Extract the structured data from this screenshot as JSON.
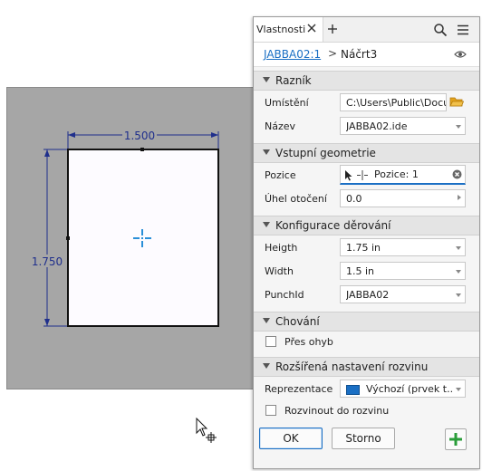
{
  "canvas": {
    "dim_width": "1.500",
    "dim_height": "1.750"
  },
  "panel": {
    "tab_label": "Vlastnosti",
    "breadcrumb": {
      "link": "JABBA02:1",
      "separator": ">",
      "current": "Náčrt3"
    },
    "sections": {
      "punch": "Razník",
      "input_geometry": "Vstupní geometrie",
      "punch_config": "Konfigurace děrování",
      "behavior": "Chování",
      "advanced": "Rozšířená nastavení rozvinu"
    },
    "fields": {
      "location_label": "Umístění",
      "location_value": "C:\\Users\\Public\\Docum",
      "name_label": "Název",
      "name_value": "JABBA02.ide",
      "position_label": "Pozice",
      "position_value": "Pozice: 1",
      "angle_label": "Úhel otočení",
      "angle_value": "0.0",
      "height_label": "Heigth",
      "height_value": "1.75 in",
      "width_label": "Width",
      "width_value": "1.5 in",
      "punchid_label": "PunchId",
      "punchid_value": "JABBA02",
      "representation_label": "Reprezentace",
      "representation_value": "Výchozí (prvek t..."
    },
    "checkboxes": {
      "over_bend": "Přes ohyb",
      "unfold": "Rozvinout do rozvinu"
    },
    "buttons": {
      "ok": "OK",
      "cancel": "Storno"
    }
  },
  "colors": {
    "accent": "#1a6fc4",
    "dimension": "#1f2f8c",
    "add_green": "#2a9d3a",
    "folder": "#e3a21a"
  }
}
